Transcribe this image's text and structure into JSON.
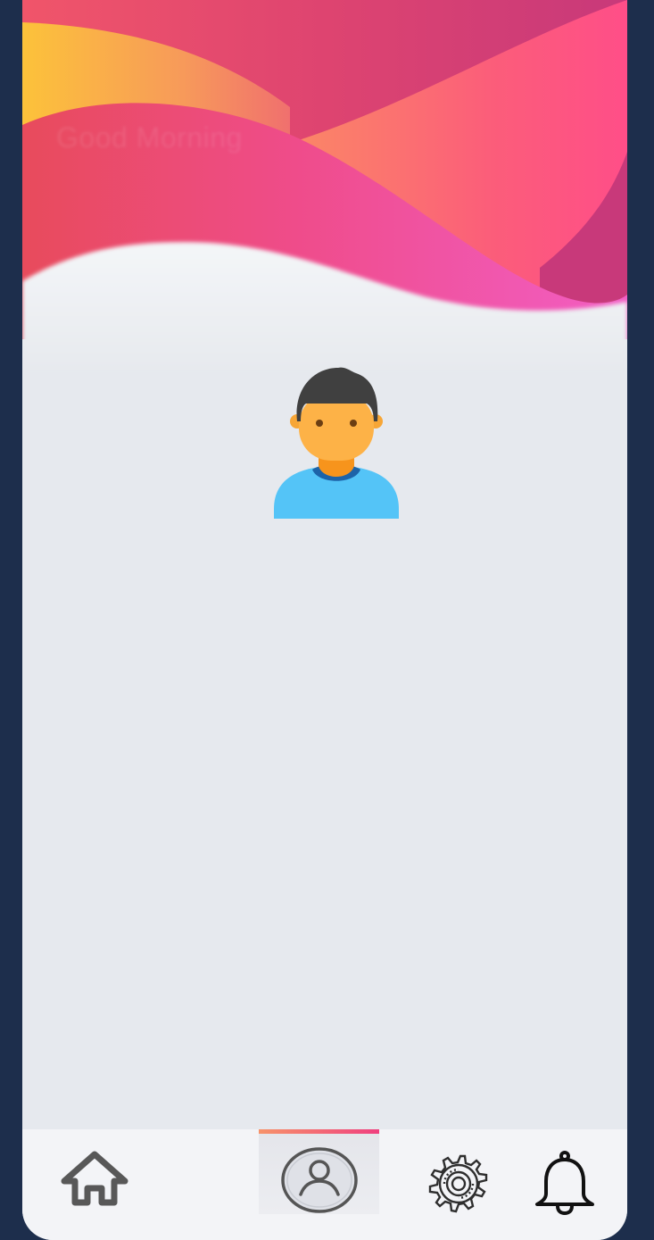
{
  "header": {
    "greeting": "Good Morning"
  },
  "profile": {
    "avatar_icon": "user-avatar-icon"
  },
  "tabbar": {
    "active_tab": "profile",
    "active_gradient": [
      "#f7936a",
      "#f0407f"
    ],
    "items": [
      {
        "id": "home",
        "icon": "home-icon"
      },
      {
        "id": "profile",
        "icon": "user-circle-icon"
      },
      {
        "id": "settings",
        "icon": "gear-icon"
      },
      {
        "id": "notifications",
        "icon": "bell-icon"
      }
    ]
  },
  "colors": {
    "frame": "#1d2e4c",
    "background": "#e6e9ee",
    "wave_yellow": "#fcc03a",
    "wave_red": "#e84c5f",
    "wave_pink": "#f0478a",
    "wave_magenta": "#cc3f78"
  }
}
